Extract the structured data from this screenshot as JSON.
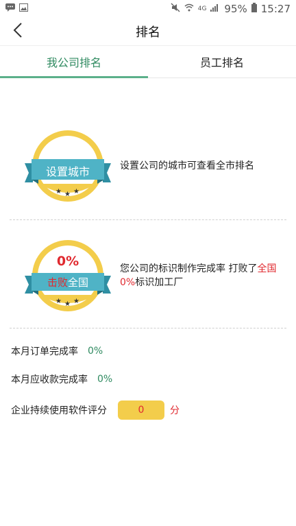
{
  "status_bar": {
    "battery": "95%",
    "time": "15:27",
    "network": "4G"
  },
  "header": {
    "title": "排名"
  },
  "tabs": [
    {
      "label": "我公司排名",
      "active": true
    },
    {
      "label": "员工排名",
      "active": false
    }
  ],
  "city_rank": {
    "badge_label": "设置城市",
    "description": "设置公司的城市可查看全市排名"
  },
  "national_rank": {
    "percent": "0%",
    "badge_label_part1": "击败",
    "badge_label_part2": "全国",
    "desc_text1": "您公司的标识制作完成率 打败了",
    "desc_highlight1": "全国",
    "desc_highlight2": "0%",
    "desc_text2": "标识加工厂"
  },
  "stats": {
    "order_label": "本月订单完成率",
    "order_value": "0%",
    "receivable_label": "本月应收款完成率",
    "receivable_value": "0%",
    "score_label": "企业持续使用软件评分",
    "score_value": "0",
    "score_unit": "分"
  },
  "colors": {
    "accent_green": "#2f8a60",
    "badge_yellow": "#f3cd4b",
    "ribbon_teal": "#4fb3c6",
    "highlight_red": "#e0292f"
  }
}
